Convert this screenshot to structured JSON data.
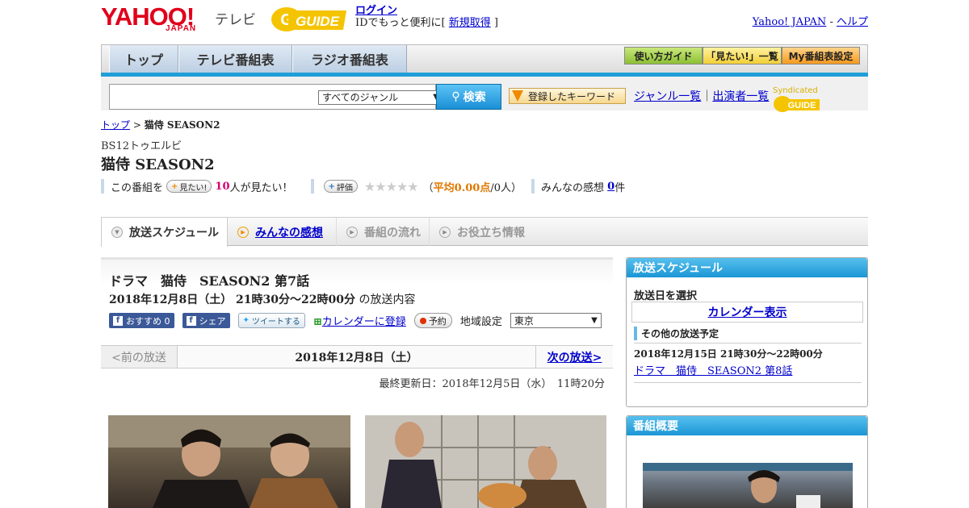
{
  "header": {
    "yahoo_logo": "YAHOO!",
    "japan_logo": "JAPAN",
    "tv_label": "テレビ",
    "gguide_logo": "GUIDE",
    "login_label": "ログイン",
    "id_text": "IDでもっと便利に[ ",
    "register_label": "新規取得",
    "id_close": " ]",
    "yahoo_japan_link": "Yahoo! JAPAN",
    "separator": " - ",
    "help_link": "ヘルプ"
  },
  "nav": {
    "tabs": [
      "トップ",
      "テレビ番組表",
      "ラジオ番組表"
    ],
    "buttons": [
      "使い方ガイド",
      "「見たい!」一覧",
      "My番組表設定"
    ]
  },
  "search": {
    "genre_value": "すべてのジャンル",
    "button_label": "検索",
    "keyword_button": "登録したキーワード",
    "genre_list_link": "ジャンル一覧",
    "divider": "｜",
    "performer_link": "出演者一覧",
    "syndicated": "Syndicated"
  },
  "breadcrumb": {
    "home": "トップ",
    "sep": " > ",
    "current": "猫侍 SEASON2"
  },
  "program": {
    "channel": "BS12トゥエルビ",
    "title": "猫侍 SEASON2",
    "mitai_prefix": "この番組を",
    "mitai_btn": "見たい!",
    "mitai_count": "10",
    "mitai_suffix": "人が見たい！",
    "rate_btn": "評価",
    "stars": "★★★★★",
    "avg_open": "（",
    "avg_label": "平均0.00点",
    "avg_count": "/0人）",
    "impression_label": "みんなの感想",
    "impression_count": "0",
    "impression_unit": "件"
  },
  "tabs": [
    {
      "label": "放送スケジュール"
    },
    {
      "label": "みんなの感想"
    },
    {
      "label": "番組の流れ"
    },
    {
      "label": "お役立ち情報"
    }
  ],
  "episode": {
    "title": "ドラマ　猫侍　SEASON2 第7話",
    "datetime": "2018年12月8日（土） 21時30分～22時00分",
    "datetime_suffix": " の放送内容",
    "recommend": "おすすめ 0",
    "share": "シェア",
    "tweet": "ツイートする",
    "calendar": "カレンダーに登録",
    "reserve": "予約",
    "region_label": "地域設定",
    "region_value": "東京"
  },
  "pager": {
    "prev": "<前の放送",
    "date": "2018年12月8日（土）",
    "next": "次の放送>"
  },
  "updated": "最終更新日：2018年12月5日（水）　11時20分",
  "sidebar": {
    "schedule_head": "放送スケジュール",
    "select_date": "放送日を選択",
    "calendar_btn": "カレンダー表示",
    "other_head": "その他の放送予定",
    "other_time": "2018年12月15日  21時30分～22時00分",
    "other_link": "ドラマ　猫侍　SEASON2 第8話",
    "summary_head": "番組概要"
  }
}
